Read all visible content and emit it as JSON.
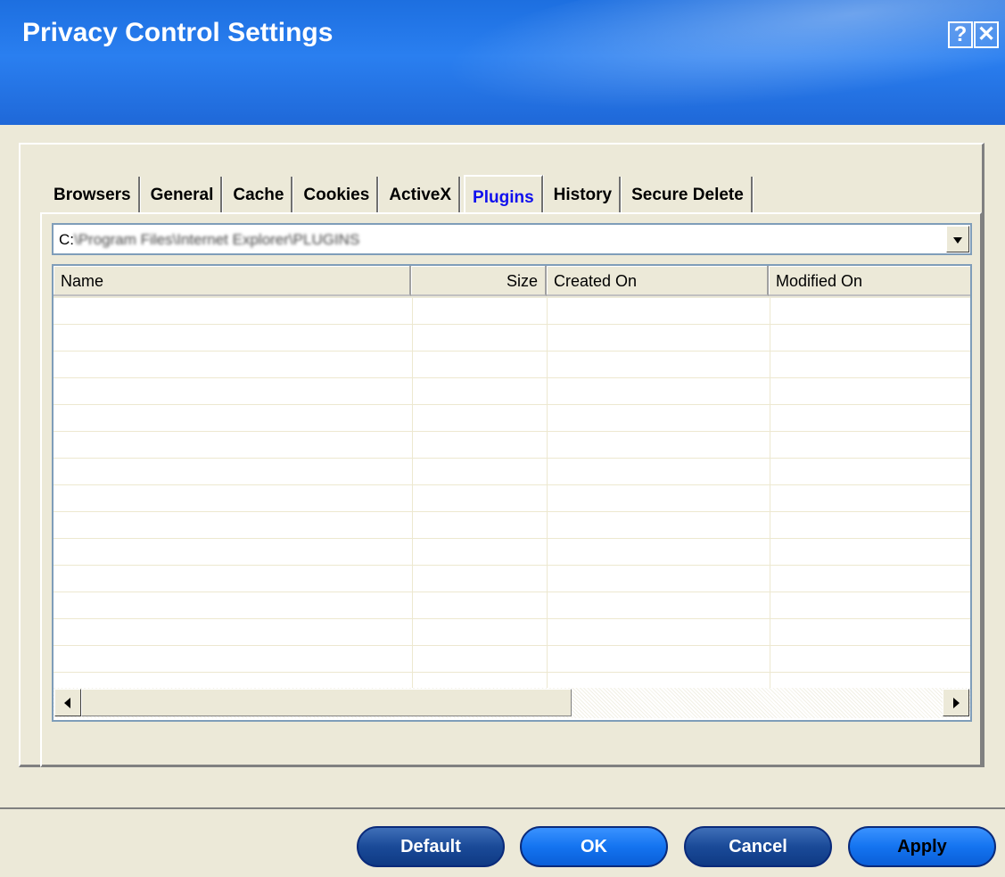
{
  "window": {
    "title": "Privacy Control Settings",
    "help_label": "?",
    "close_label": "✕"
  },
  "tabs": [
    {
      "label": "Browsers",
      "active": false
    },
    {
      "label": "General",
      "active": false
    },
    {
      "label": "Cache",
      "active": false
    },
    {
      "label": "Cookies",
      "active": false
    },
    {
      "label": "ActiveX",
      "active": false
    },
    {
      "label": "Plugins",
      "active": true
    },
    {
      "label": "History",
      "active": false
    },
    {
      "label": "Secure Delete",
      "active": false
    }
  ],
  "path_combo": {
    "drive_prefix": "C:",
    "path_text": "\\Program Files\\Internet Explorer\\PLUGINS",
    "path_blurred": true
  },
  "list": {
    "columns": [
      "Name",
      "Size",
      "Created On",
      "Modified On"
    ],
    "rows": []
  },
  "buttons": {
    "default": "Default",
    "ok": "OK",
    "cancel": "Cancel",
    "apply": "Apply"
  },
  "colors": {
    "banner_blue": "#1d6fe0",
    "active_tab_text": "#1010ee",
    "dialog_bg": "#ece9d8"
  }
}
